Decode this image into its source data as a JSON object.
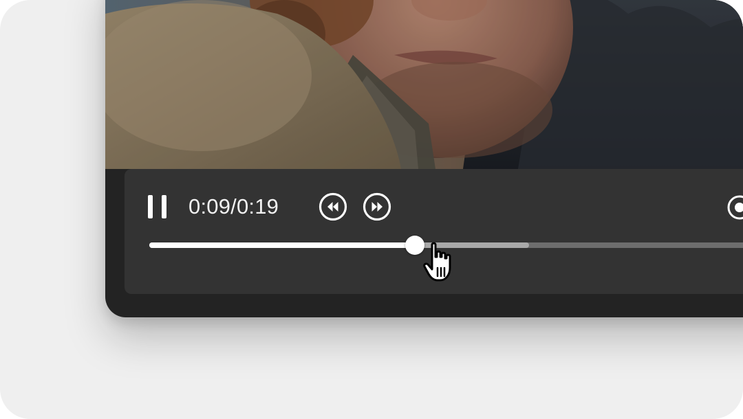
{
  "player": {
    "time_display": "0:09/0:19",
    "playback_state": "playing",
    "played_fraction": 0.42,
    "buffered_fraction": 0.6,
    "controls": {
      "pause": {
        "icon": "pause-icon"
      },
      "rewind": {
        "icon": "rewind-icon"
      },
      "fast_forward": {
        "icon": "fast-forward-icon"
      },
      "record": {
        "icon": "record-icon"
      }
    }
  },
  "cursor": {
    "icon": "hand-pointer-icon"
  },
  "colors": {
    "background": "#efefef",
    "player_frame": "#232323",
    "control_bar": "#343434",
    "progress_played": "#ffffff",
    "progress_buffered": "#a9a9a9",
    "progress_track": "#6e6e6e",
    "icon": "#ffffff"
  }
}
